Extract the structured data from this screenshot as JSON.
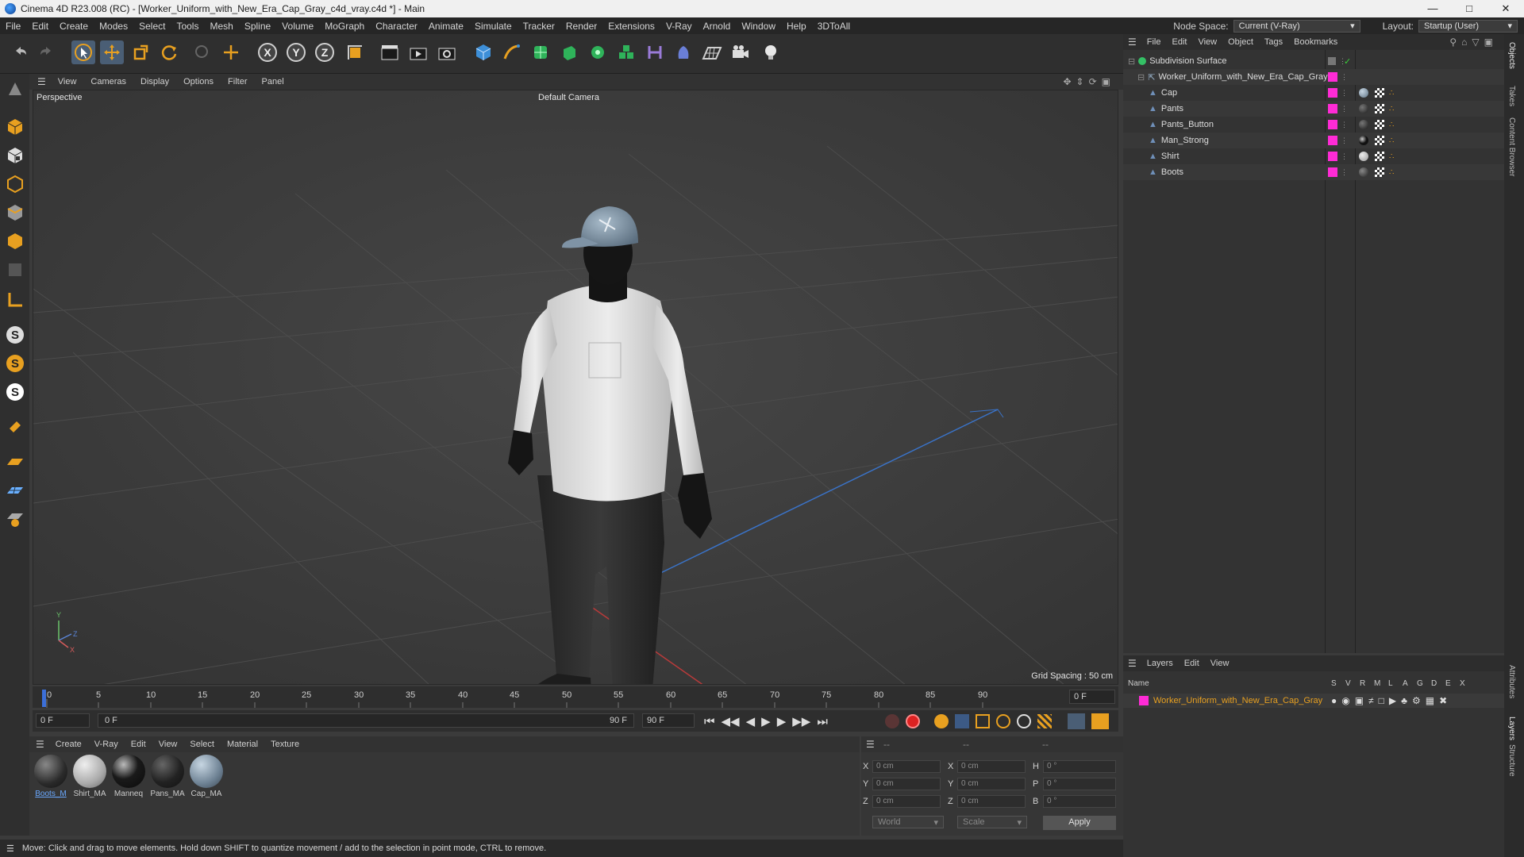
{
  "titlebar": {
    "title": "Cinema 4D R23.008 (RC) - [Worker_Uniform_with_New_Era_Cap_Gray_c4d_vray.c4d *] - Main"
  },
  "menubar": {
    "items": [
      "File",
      "Edit",
      "Create",
      "Modes",
      "Select",
      "Tools",
      "Mesh",
      "Spline",
      "Volume",
      "MoGraph",
      "Character",
      "Animate",
      "Simulate",
      "Tracker",
      "Render",
      "Extensions",
      "V-Ray",
      "Arnold",
      "Window",
      "Help",
      "3DToAll"
    ],
    "node_space_label": "Node Space:",
    "node_space_value": "Current (V-Ray)",
    "layout_label": "Layout:",
    "layout_value": "Startup (User)"
  },
  "viewport": {
    "menu": [
      "View",
      "Cameras",
      "Display",
      "Options",
      "Filter",
      "Panel"
    ],
    "view_name": "Perspective",
    "camera": "Default Camera",
    "grid_spacing": "Grid Spacing : 50 cm"
  },
  "timeline": {
    "ticks": [
      "0",
      "5",
      "10",
      "15",
      "20",
      "25",
      "30",
      "35",
      "40",
      "45",
      "50",
      "55",
      "60",
      "65",
      "70",
      "75",
      "80",
      "85",
      "90"
    ],
    "current_frame": "0 F",
    "start_frame": "0 F",
    "range_start": "0 F",
    "range_end": "90 F",
    "end_frame": "90 F"
  },
  "material_manager": {
    "menu": [
      "Create",
      "V-Ray",
      "Edit",
      "View",
      "Select",
      "Material",
      "Texture"
    ],
    "materials": [
      {
        "name": "Boots_M"
      },
      {
        "name": "Shirt_MA"
      },
      {
        "name": "Manneq"
      },
      {
        "name": "Pans_MA"
      },
      {
        "name": "Cap_MA"
      }
    ]
  },
  "coordinates": {
    "headers": [
      "--",
      "--",
      "--"
    ],
    "rows": [
      {
        "a": "X",
        "av": "0 cm",
        "b": "X",
        "bv": "0 cm",
        "c": "H",
        "cv": "0 °"
      },
      {
        "a": "Y",
        "av": "0 cm",
        "b": "Y",
        "bv": "0 cm",
        "c": "P",
        "cv": "0 °"
      },
      {
        "a": "Z",
        "av": "0 cm",
        "b": "Z",
        "bv": "0 cm",
        "c": "B",
        "cv": "0 °"
      }
    ],
    "space": "World",
    "mode": "Scale",
    "apply": "Apply"
  },
  "status": {
    "text": "Move: Click and drag to move elements. Hold down SHIFT to quantize movement / add to the selection in point mode, CTRL to remove."
  },
  "object_manager": {
    "menu": [
      "File",
      "Edit",
      "View",
      "Object",
      "Tags",
      "Bookmarks"
    ],
    "objects": [
      {
        "name": "Subdivision Surface",
        "level": 0
      },
      {
        "name": "Worker_Uniform_with_New_Era_Cap_Gray",
        "level": 1
      },
      {
        "name": "Cap",
        "level": 2
      },
      {
        "name": "Pants",
        "level": 2
      },
      {
        "name": "Pants_Button",
        "level": 2
      },
      {
        "name": "Man_Strong",
        "level": 2
      },
      {
        "name": "Shirt",
        "level": 2
      },
      {
        "name": "Boots",
        "level": 2
      }
    ],
    "layer_color": "#ff2bd6"
  },
  "layers": {
    "menu": [
      "Layers",
      "Edit",
      "View"
    ],
    "columns": [
      "Name",
      "S",
      "V",
      "R",
      "M",
      "L",
      "A",
      "G",
      "D",
      "E",
      "X"
    ],
    "rows": [
      {
        "name": "Worker_Uniform_with_New_Era_Cap_Gray",
        "color": "#ff2bd6"
      }
    ]
  },
  "right_tabs": [
    "Objects",
    "Takes",
    "Content Browser",
    "Attributes",
    "Layers",
    "Structure"
  ]
}
